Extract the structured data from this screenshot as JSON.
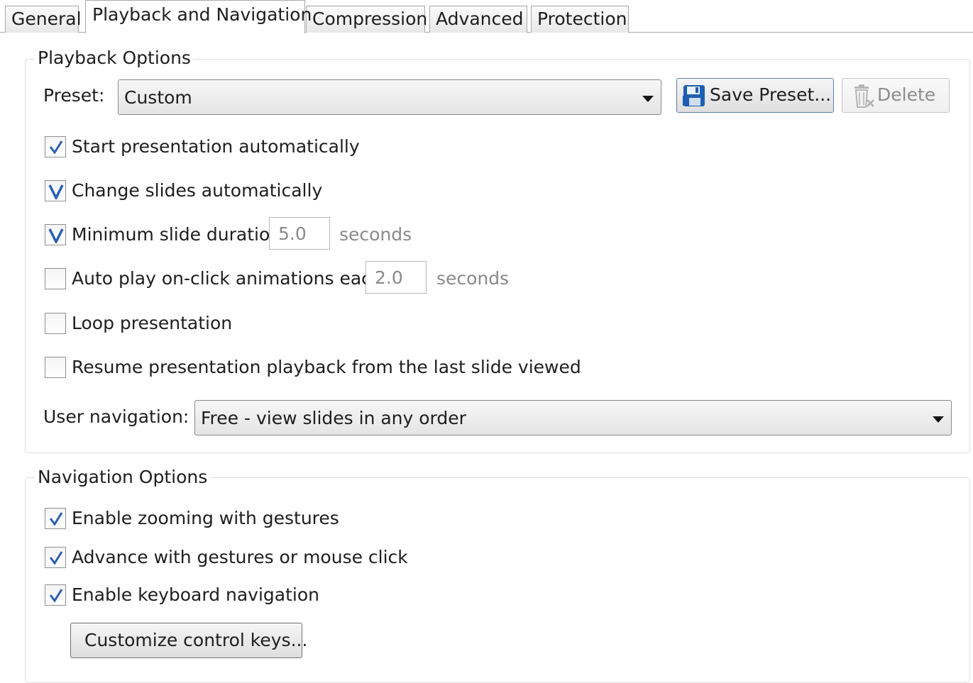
{
  "tabs": [
    {
      "label": "General",
      "active": false
    },
    {
      "label": "Playback and Navigation",
      "active": true
    },
    {
      "label": "Compression",
      "active": false
    },
    {
      "label": "Advanced",
      "active": false
    },
    {
      "label": "Protection",
      "active": false
    }
  ],
  "playback": {
    "title": "Playback Options",
    "preset_label": "Preset:",
    "preset_value": "Custom",
    "save_preset_label": "Save Preset...",
    "delete_label": "Delete",
    "options": [
      {
        "label": "Start presentation automatically",
        "checked": true
      },
      {
        "label": "Change slides automatically",
        "checked": true
      },
      {
        "label": "Minimum slide duration",
        "checked": true
      },
      {
        "label": "Auto play on-click animations each",
        "checked": false
      },
      {
        "label": "Loop presentation",
        "checked": false
      },
      {
        "label": "Resume presentation playback from the last slide viewed",
        "checked": false
      }
    ],
    "min_duration_value": "5.0",
    "min_duration_unit": "seconds",
    "autoplay_value": "2.0",
    "autoplay_unit": "seconds",
    "user_nav_label": "User navigation:",
    "user_nav_value": "Free - view slides in any order"
  },
  "navigation": {
    "title": "Navigation Options",
    "options": [
      {
        "label": "Enable zooming with gestures",
        "checked": true
      },
      {
        "label": "Advance with gestures or mouse click",
        "checked": true
      },
      {
        "label": "Enable keyboard navigation",
        "checked": true
      }
    ],
    "customize_keys_label": "Customize control keys..."
  },
  "colors": {
    "check_mark": "#2b5fb4",
    "save_icon": "#1d5fb0"
  },
  "icons": {
    "save": "floppy-disk-icon",
    "delete": "trash-delete-icon",
    "dropdown": "chevron-down-icon",
    "check": "checkmark-icon"
  }
}
